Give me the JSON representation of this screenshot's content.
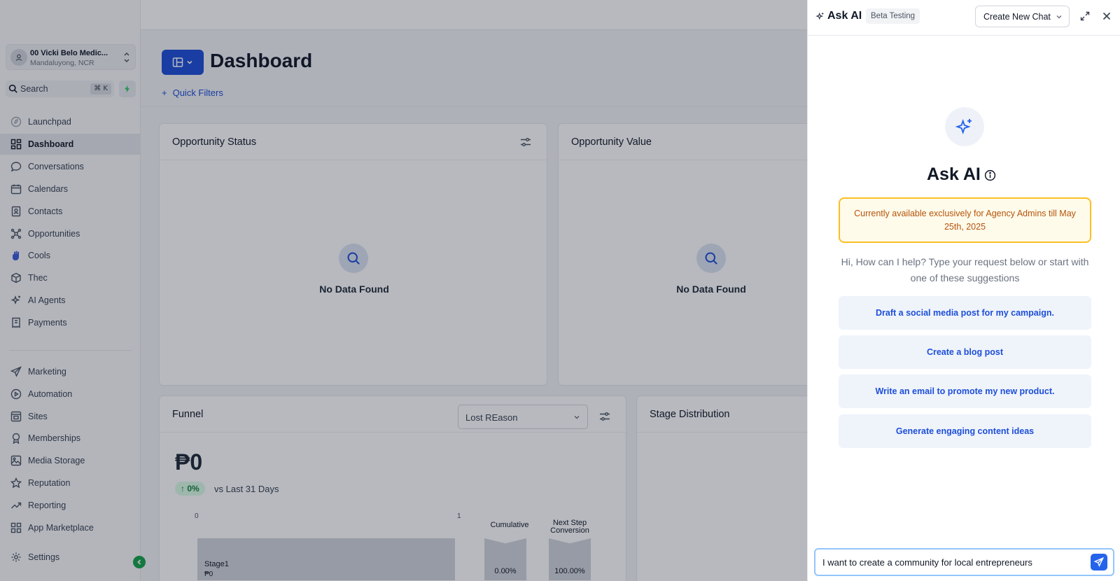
{
  "location": {
    "name": "00 Vicki Belo Medic...",
    "sub": "Mandaluyong, NCR"
  },
  "search": {
    "label": "Search",
    "shortcut": "⌘ K"
  },
  "nav": [
    {
      "label": "Launchpad",
      "icon": "launchpad-icon"
    },
    {
      "label": "Dashboard",
      "icon": "dashboard-icon",
      "active": true
    },
    {
      "label": "Conversations",
      "icon": "chat-bubble-icon"
    },
    {
      "label": "Calendars",
      "icon": "calendar-icon"
    },
    {
      "label": "Contacts",
      "icon": "contacts-icon"
    },
    {
      "label": "Opportunities",
      "icon": "opportunities-icon"
    },
    {
      "label": "Cools",
      "icon": "hand-icon"
    },
    {
      "label": "Thec",
      "icon": "box-icon"
    },
    {
      "label": "AI Agents",
      "icon": "ai-sparkle-icon"
    },
    {
      "label": "Payments",
      "icon": "receipt-icon"
    },
    {
      "label": "Marketing",
      "icon": "send-icon"
    },
    {
      "label": "Automation",
      "icon": "play-circle-icon"
    },
    {
      "label": "Sites",
      "icon": "sites-icon"
    },
    {
      "label": "Memberships",
      "icon": "award-icon"
    },
    {
      "label": "Media Storage",
      "icon": "image-icon"
    },
    {
      "label": "Reputation",
      "icon": "star-icon"
    },
    {
      "label": "Reporting",
      "icon": "trend-icon"
    },
    {
      "label": "App Marketplace",
      "icon": "grid-icon"
    },
    {
      "label": "Settings",
      "icon": "gear-icon"
    }
  ],
  "main": {
    "title": "Dashboard",
    "quick_filters": "Quick Filters",
    "opportunity_status": {
      "title": "Opportunity Status",
      "empty": "No Data Found"
    },
    "opportunity_value": {
      "title": "Opportunity Value",
      "empty": "No Data Found"
    },
    "funnel": {
      "title": "Funnel",
      "select_value": "Lost REason",
      "amount": "₱0",
      "trend": "0%",
      "trend_text": "vs Last 31 Days",
      "axis_min": "0",
      "axis_max": "1",
      "stage_name": "Stage1",
      "stage_value": "₱0",
      "cumulative_label": "Cumulative",
      "cumulative_value": "0.00%",
      "next_step_label_1": "Next Step",
      "next_step_label_2": "Conversion",
      "next_step_value": "100.00%"
    },
    "stage_distribution": {
      "title": "Stage Distribution"
    }
  },
  "panel": {
    "title": "Ask AI",
    "badge": "Beta Testing",
    "new_chat": "Create New Chat",
    "hero_title": "Ask AI",
    "notice": "Currently available exclusively for Agency Admins till May 25th, 2025",
    "help": "Hi, How can I help? Type your request below or start with one of these suggestions",
    "suggestions": [
      "Draft a social media post for my campaign.",
      "Create a blog post",
      "Write an email to promote my new product.",
      "Generate engaging content ideas"
    ],
    "input_value": "I want to create a community for local entrepreneurs"
  },
  "colors": {
    "primary": "#1d4ed8",
    "accent_green": "#16a34a",
    "notice_border": "#fbbf24",
    "notice_text": "#b45309"
  }
}
